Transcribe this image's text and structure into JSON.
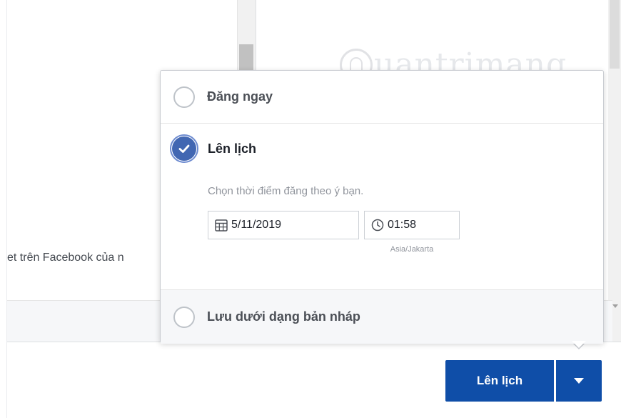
{
  "background": {
    "preview_text": "et trên Facebook của n"
  },
  "watermark": {
    "text": "uantrimang"
  },
  "popup": {
    "option_now": {
      "label": "Đăng ngay",
      "selected": false
    },
    "option_schedule": {
      "label": "Lên lịch",
      "selected": true,
      "hint": "Chọn thời điểm đăng theo ý bạn.",
      "date": "5/11/2019",
      "time": "01:58",
      "timezone": "Asia/Jakarta"
    },
    "option_draft": {
      "label": "Lưu dưới dạng bản nháp",
      "selected": false
    }
  },
  "footer": {
    "submit_label": "Lên lịch"
  },
  "colors": {
    "primary": "#0f4ea8",
    "check": "#4267b2"
  },
  "icons": {
    "date": "calendar-icon",
    "time": "clock-icon",
    "dropdown": "caret-down-icon"
  }
}
